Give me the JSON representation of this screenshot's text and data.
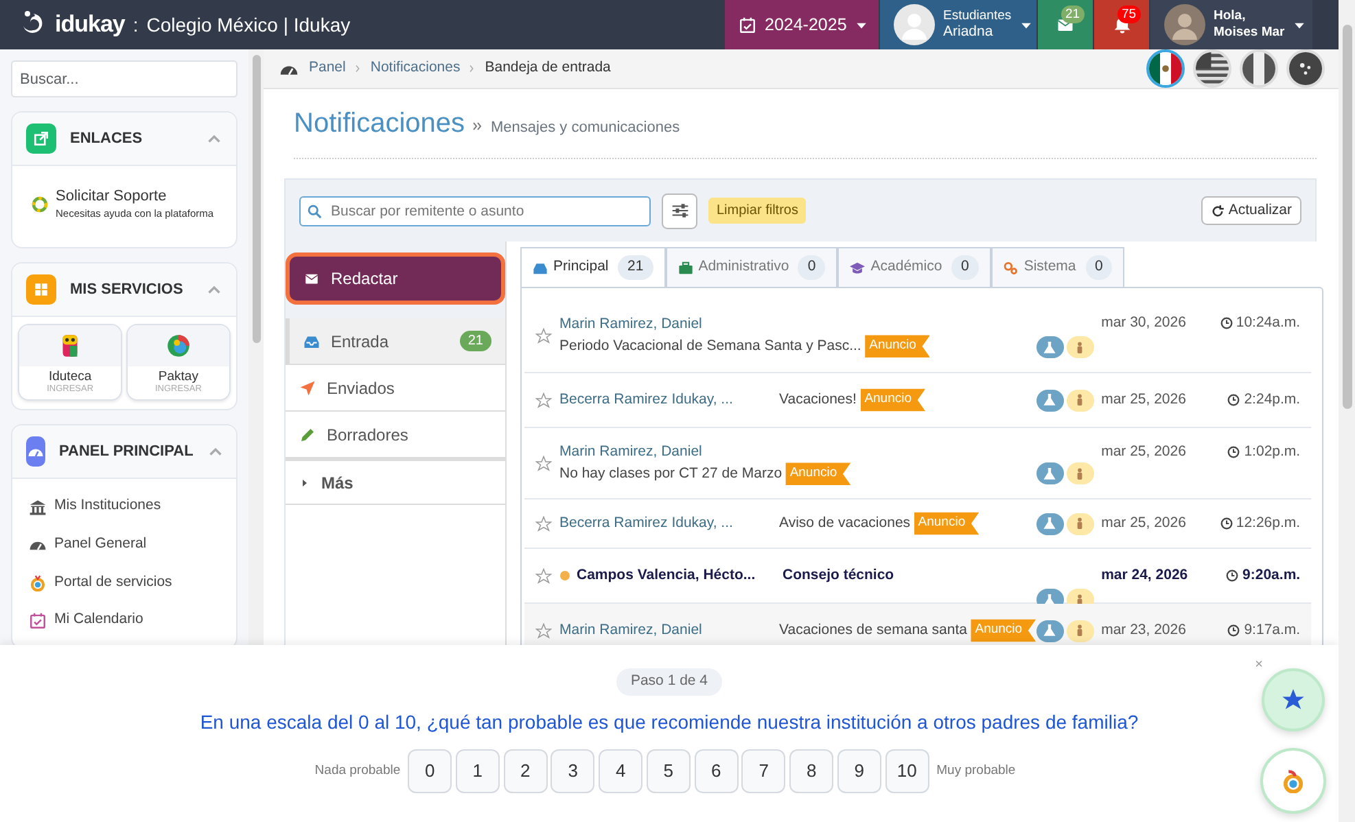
{
  "navbar": {
    "brand": "idukay",
    "separator": ":",
    "school": "Colegio México | Idukay",
    "year": "2024-2025",
    "role": "Estudiantes",
    "student": "Ariadna",
    "messages_count": "21",
    "notifications_count": "75",
    "greeting": "Hola,",
    "user": "Moises Mar"
  },
  "sidebar": {
    "search": {
      "placeholder": "Buscar..."
    },
    "sections": [
      {
        "kind": "links",
        "title": "ENLACES",
        "expanded": true,
        "items": [
          {
            "title": "Solicitar Soporte",
            "subtitle": "Necesitas ayuda con la plataforma"
          }
        ]
      },
      {
        "kind": "services",
        "title": "MIS SERVICIOS",
        "expanded": true,
        "items": [
          {
            "title": "Iduteca",
            "subtitle": "INGRESAR"
          },
          {
            "title": "Paktay",
            "subtitle": "INGRESAR"
          }
        ]
      },
      {
        "kind": "panel",
        "title": "PANEL PRINCIPAL",
        "expanded": true,
        "items": [
          {
            "title": "Mis Instituciones"
          },
          {
            "title": "Panel General"
          },
          {
            "title": "Portal de servicios"
          },
          {
            "title": "Mi Calendario"
          }
        ]
      }
    ]
  },
  "breadcrumb": [
    "Panel",
    "Notificaciones",
    "Bandeja de entrada"
  ],
  "languages": [
    {
      "kind": "mx",
      "selected": true
    },
    {
      "kind": "us",
      "selected": false
    },
    {
      "kind": "pe",
      "selected": false
    },
    {
      "kind": "other",
      "selected": false
    }
  ],
  "heading": {
    "title": "Notificaciones",
    "subtitle": "Mensajes y comunicaciones"
  },
  "toolbar": {
    "search_placeholder": "Buscar por remitente o asunto",
    "clear": "Limpiar filtros",
    "refresh": "Actualizar"
  },
  "compose": "Redactar",
  "folders": [
    {
      "kind": "inbox",
      "label": "Entrada",
      "count": "21",
      "selected": true
    },
    {
      "kind": "sent",
      "label": "Enviados",
      "selected": false
    },
    {
      "kind": "drafts",
      "label": "Borradores",
      "selected": false
    },
    {
      "kind": "more",
      "label": "Más",
      "selected": false
    }
  ],
  "tabs": [
    {
      "kind": "inbox",
      "label": "Principal",
      "count": "21",
      "selected": true
    },
    {
      "kind": "briefcase",
      "label": "Administrativo",
      "count": "0",
      "selected": false
    },
    {
      "kind": "cap",
      "label": "Académico",
      "count": "0",
      "selected": false
    },
    {
      "kind": "gears",
      "label": "Sistema",
      "count": "0",
      "selected": false
    }
  ],
  "messages": [
    {
      "kind": "two_line",
      "sender": "Marin Ramirez, Daniel",
      "subject": "Periodo Vacacional de Semana Santa y Pasc...",
      "tag": "Anuncio",
      "date": "mar 30, 2026",
      "time": "10:24a.m.",
      "unread": false
    },
    {
      "kind": "one_line",
      "sender": "Becerra Ramirez Idukay, ...",
      "subject": "Vacaciones!",
      "tag": "Anuncio",
      "date": "mar 25, 2026",
      "time": "2:24p.m.",
      "unread": false
    },
    {
      "kind": "two_line",
      "sender": "Marin Ramirez, Daniel",
      "subject": "No hay clases por CT 27 de Marzo",
      "tag": "Anuncio",
      "date": "mar 25, 2026",
      "time": "1:02p.m.",
      "unread": false
    },
    {
      "kind": "one_line",
      "sender": "Becerra Ramirez Idukay, ...",
      "subject": "Aviso de vacaciones",
      "tag": "Anuncio",
      "date": "mar 25, 2026",
      "time": "12:26p.m.",
      "unread": false
    },
    {
      "kind": "one_line",
      "sender": "Campos Valencia, Hécto...",
      "subject": "Consejo técnico",
      "date": "mar 24, 2026",
      "time": "9:20a.m.",
      "unread": true
    },
    {
      "kind": "one_line",
      "sender": "Marin Ramirez, Daniel",
      "subject": "Vacaciones de semana santa",
      "tag": "Anuncio",
      "date": "mar 23, 2026",
      "time": "9:17a.m.",
      "unread": false
    }
  ],
  "survey": {
    "step": "Paso 1 de 4",
    "question": "En una escala del 0 al 10, ¿qué tan probable es que recomiende nuestra institución a otros padres de familia?",
    "low_label": "Nada probable",
    "high_label": "Muy probable",
    "options": [
      "0",
      "1",
      "2",
      "3",
      "4",
      "5",
      "6",
      "7",
      "8",
      "9",
      "10"
    ],
    "close": "×"
  }
}
